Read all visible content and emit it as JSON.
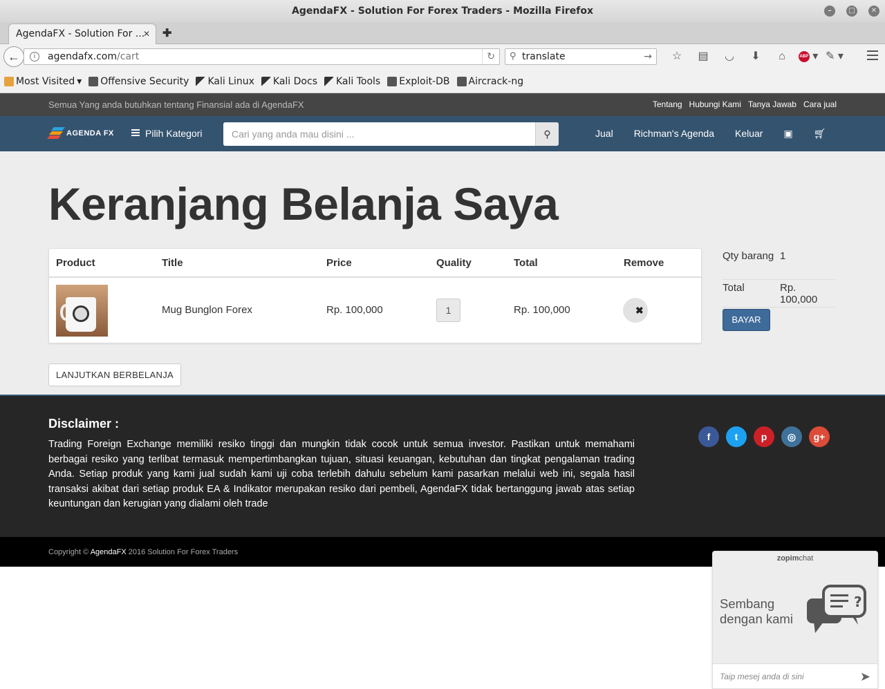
{
  "window": {
    "title": "AgendaFX - Solution For Forex Traders - Mozilla Firefox"
  },
  "browser": {
    "tab_title": "AgendaFX - Solution For ...",
    "url_host": "agendafx.com",
    "url_path": "/cart",
    "search_value": "translate",
    "bookmarks": [
      "Most Visited",
      "Offensive Security",
      "Kali Linux",
      "Kali Docs",
      "Kali Tools",
      "Exploit-DB",
      "Aircrack-ng"
    ]
  },
  "site": {
    "tagline": "Semua Yang anda butuhkan tentang Finansial ada di AgendaFX",
    "top_links": [
      "Tentang",
      "Hubungi Kami",
      "Tanya Jawab",
      "Cara jual"
    ],
    "logo_text": "AGENDA FX",
    "category_button": "Pilih Kategori",
    "search_placeholder": "Cari yang anda mau disini ...",
    "nav_links": [
      "Jual",
      "Richman's Agenda",
      "Keluar"
    ]
  },
  "cart": {
    "heading": "Keranjang Belanja Saya",
    "columns": [
      "Product",
      "Title",
      "Price",
      "Quality",
      "Total",
      "Remove"
    ],
    "items": [
      {
        "title": "Mug Bunglon Forex",
        "price": "Rp. 100,000",
        "qty": "1",
        "total": "Rp. 100,000"
      }
    ],
    "summary": {
      "qty_label": "Qty barang",
      "qty_value": "1",
      "total_label": "Total",
      "total_value": "Rp. 100,000",
      "pay_button": "BAYAR"
    },
    "continue_button": "LANJUTKAN BERBELANJA"
  },
  "footer": {
    "disclaimer_title": "Disclaimer :",
    "disclaimer_text": "Trading Foreign Exchange memiliki resiko tinggi dan mungkin tidak cocok untuk semua investor. Pastikan untuk memahami berbagai resiko yang terlibat termasuk mempertimbangkan tujuan, situasi keuangan, kebutuhan dan tingkat pengalaman trading Anda. Setiap produk yang kami jual sudah kami uji coba terlebih dahulu sebelum kami pasarkan melalui web ini, segala hasil transaksi akibat dari setiap produk EA & Indikator merupakan resiko dari pembeli, AgendaFX tidak bertanggung jawab atas setiap keuntungan dan kerugian yang dialami oleh trade",
    "socials": [
      {
        "name": "facebook-icon",
        "glyph": "f",
        "color": "#3b5998"
      },
      {
        "name": "twitter-icon",
        "glyph": "t",
        "color": "#1da1f2"
      },
      {
        "name": "pinterest-icon",
        "glyph": "p",
        "color": "#cb2027"
      },
      {
        "name": "instagram-icon",
        "glyph": "◎",
        "color": "#3f729b"
      },
      {
        "name": "google-plus-icon",
        "glyph": "g+",
        "color": "#dd4b39"
      }
    ],
    "copyright_prefix": "Copyright © ",
    "copyright_brand": "AgendaFX",
    "copyright_suffix": " 2016 Solution For Forex Traders"
  },
  "chat": {
    "brand_bold": "zopim",
    "brand_thin": "chat",
    "message_line1": "Sembang",
    "message_line2": "dengan kami",
    "input_placeholder": "Taip mesej anda di sini"
  },
  "colors": {
    "nav": "#34536f",
    "topbar": "#454545",
    "content_bg": "#ededed",
    "footer": "#262626",
    "pay_button": "#3f6b9a"
  }
}
